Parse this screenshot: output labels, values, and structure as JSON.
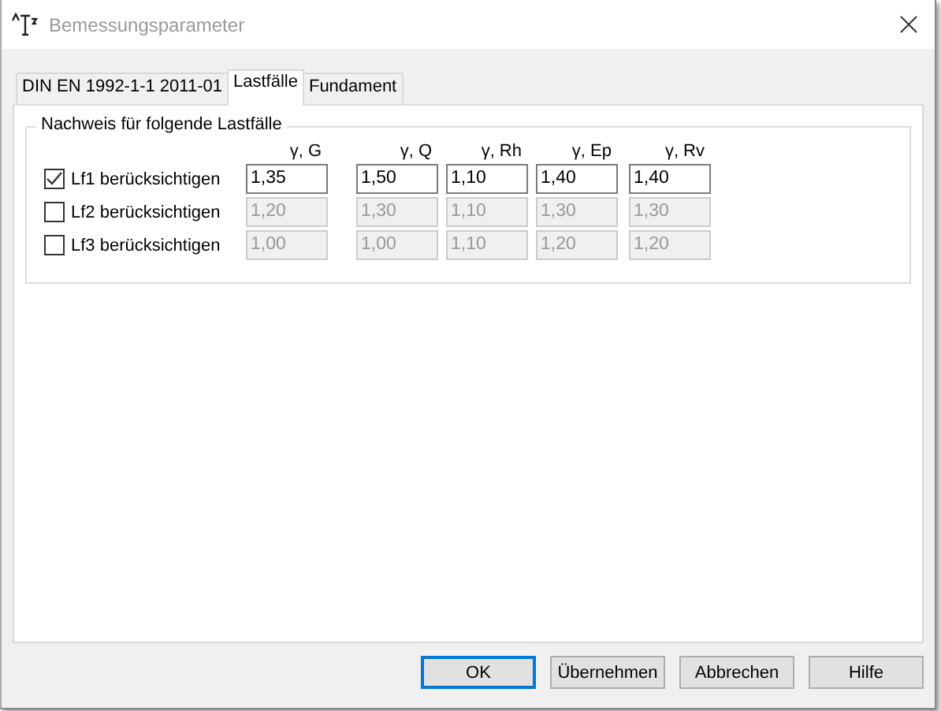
{
  "window": {
    "title": "Bemessungsparameter"
  },
  "tabs": [
    {
      "label": "DIN EN 1992-1-1 2011-01",
      "selected": false
    },
    {
      "label": "Lastfälle",
      "selected": true
    },
    {
      "label": "Fundament",
      "selected": false
    }
  ],
  "group": {
    "title": "Nachweis für folgende Lastfälle",
    "columns": [
      "γ, G",
      "γ, Q",
      "γ, Rh",
      "γ, Ep",
      "γ, Rv"
    ],
    "rows": [
      {
        "label": "Lf1 berücksichtigen",
        "checked": true,
        "values": [
          "1,35",
          "1,50",
          "1,10",
          "1,40",
          "1,40"
        ]
      },
      {
        "label": "Lf2 berücksichtigen",
        "checked": false,
        "values": [
          "1,20",
          "1,30",
          "1,10",
          "1,30",
          "1,30"
        ]
      },
      {
        "label": "Lf3 berücksichtigen",
        "checked": false,
        "values": [
          "1,00",
          "1,00",
          "1,10",
          "1,20",
          "1,20"
        ]
      }
    ]
  },
  "buttons": [
    {
      "label": "OK",
      "default": true
    },
    {
      "label": "Übernehmen",
      "default": false
    },
    {
      "label": "Abbrechen",
      "default": false
    },
    {
      "label": "Hilfe",
      "default": false
    }
  ]
}
